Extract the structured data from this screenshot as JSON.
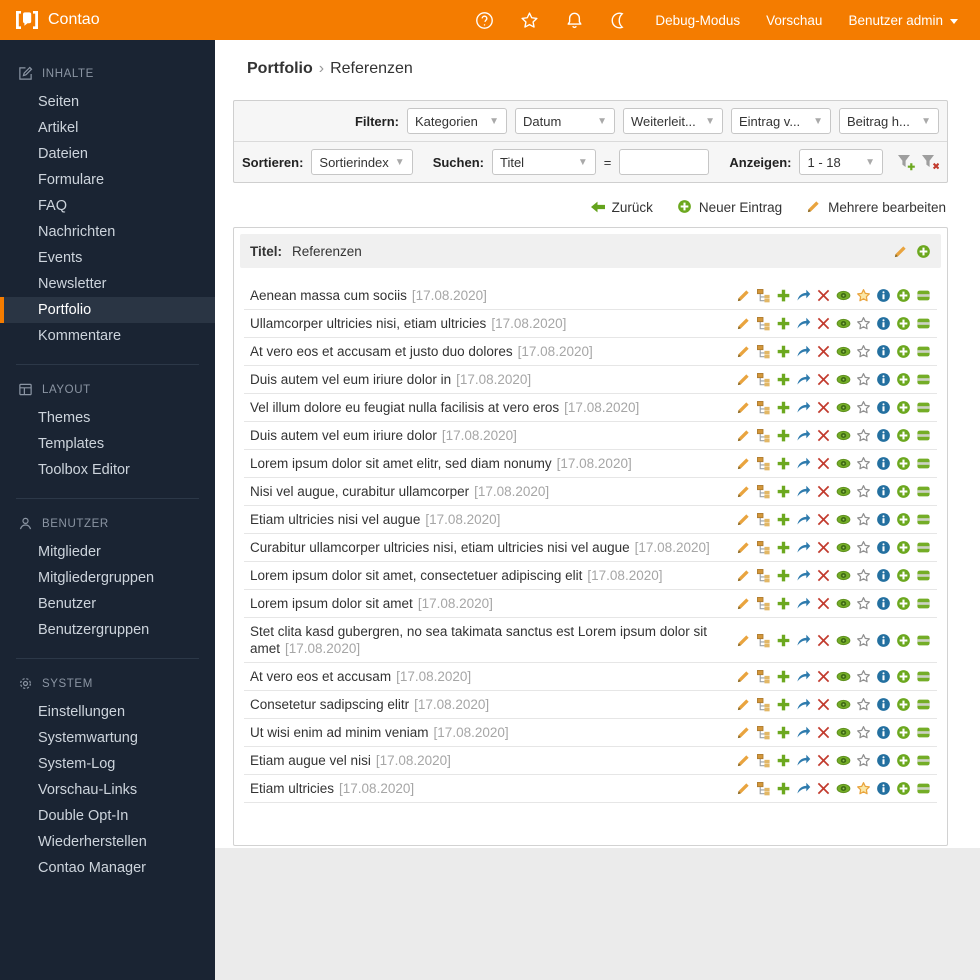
{
  "header": {
    "brand": "Contao",
    "icon_names": [
      "help-icon",
      "favorites-star-icon",
      "notifications-bell-icon",
      "dark-mode-moon-icon"
    ],
    "links": [
      {
        "label": "Debug-Modus"
      },
      {
        "label": "Vorschau"
      },
      {
        "label": "Benutzer admin"
      }
    ]
  },
  "sidebar": {
    "sections": [
      {
        "title": "Inhalte",
        "icon": "edit-square-icon",
        "items": [
          {
            "label": "Seiten"
          },
          {
            "label": "Artikel"
          },
          {
            "label": "Dateien"
          },
          {
            "label": "Formulare"
          },
          {
            "label": "FAQ"
          },
          {
            "label": "Nachrichten"
          },
          {
            "label": "Events"
          },
          {
            "label": "Newsletter"
          },
          {
            "label": "Portfolio",
            "active": true
          },
          {
            "label": "Kommentare"
          }
        ]
      },
      {
        "title": "Layout",
        "icon": "layout-icon",
        "items": [
          {
            "label": "Themes"
          },
          {
            "label": "Templates"
          },
          {
            "label": "Toolbox Editor"
          }
        ]
      },
      {
        "title": "Benutzer",
        "icon": "user-icon",
        "items": [
          {
            "label": "Mitglieder"
          },
          {
            "label": "Mitgliedergruppen"
          },
          {
            "label": "Benutzer"
          },
          {
            "label": "Benutzergruppen"
          }
        ]
      },
      {
        "title": "System",
        "icon": "gear-icon",
        "items": [
          {
            "label": "Einstellungen"
          },
          {
            "label": "Systemwartung"
          },
          {
            "label": "System-Log"
          },
          {
            "label": "Vorschau-Links"
          },
          {
            "label": "Double Opt-In"
          },
          {
            "label": "Wiederherstellen"
          },
          {
            "label": "Contao Manager"
          }
        ]
      }
    ]
  },
  "breadcrumb": {
    "parent": "Portfolio",
    "separator": "›",
    "current": "Referenzen"
  },
  "filter": {
    "label": "Filtern:",
    "selects": [
      {
        "value": "Kategorien"
      },
      {
        "value": "Datum"
      },
      {
        "value": "Weiterleit..."
      },
      {
        "value": "Eintrag v..."
      },
      {
        "value": "Beitrag h..."
      }
    ]
  },
  "sort": {
    "sort_label": "Sortieren:",
    "sort_value": "Sortierindex",
    "search_label": "Suchen:",
    "search_value": "Titel",
    "equals": "=",
    "search_input": "",
    "show_label": "Anzeigen:",
    "show_value": "1 - 18",
    "funnel_icons": [
      "funnel-add-icon",
      "funnel-remove-icon"
    ]
  },
  "actions": [
    {
      "label": "Zurück",
      "icon": "back-arrow-icon"
    },
    {
      "label": "Neuer Eintrag",
      "icon": "new-plus-icon"
    },
    {
      "label": "Mehrere bearbeiten",
      "icon": "edit-pencil-icon"
    }
  ],
  "list": {
    "header_label": "Titel:",
    "header_value": "Referenzen",
    "header_icons": [
      "edit-pencil-icon",
      "new-plus-icon"
    ],
    "row_action_icons": [
      "edit-pencil",
      "children",
      "copy-plus",
      "cut-arrow",
      "delete-x",
      "visibility-eye",
      "feature-star",
      "info",
      "new-after",
      "paste-after"
    ],
    "rows": [
      {
        "title": "Aenean massa cum sociis",
        "date": "[17.08.2020]",
        "featured": true
      },
      {
        "title": "Ullamcorper ultricies nisi, etiam ultricies",
        "date": "[17.08.2020]",
        "featured": false
      },
      {
        "title": "At vero eos et accusam et justo duo dolores",
        "date": "[17.08.2020]",
        "featured": false
      },
      {
        "title": "Duis autem vel eum iriure dolor in",
        "date": "[17.08.2020]",
        "featured": false
      },
      {
        "title": "Vel illum dolore eu feugiat nulla facilisis at vero eros",
        "date": "[17.08.2020]",
        "featured": false
      },
      {
        "title": "Duis autem vel eum iriure dolor",
        "date": "[17.08.2020]",
        "featured": false
      },
      {
        "title": "Lorem ipsum dolor sit amet elitr, sed diam nonumy",
        "date": "[17.08.2020]",
        "featured": false
      },
      {
        "title": "Nisi vel augue, curabitur ullamcorper",
        "date": "[17.08.2020]",
        "featured": false
      },
      {
        "title": "Etiam ultricies nisi vel augue",
        "date": "[17.08.2020]",
        "featured": false
      },
      {
        "title": "Curabitur ullamcorper ultricies nisi, etiam ultricies nisi vel augue",
        "date": "[17.08.2020]",
        "featured": false
      },
      {
        "title": "Lorem ipsum dolor sit amet, consectetuer adipiscing elit",
        "date": "[17.08.2020]",
        "featured": false
      },
      {
        "title": "Lorem ipsum dolor sit amet",
        "date": "[17.08.2020]",
        "featured": false
      },
      {
        "title": "Stet clita kasd gubergren, no sea takimata sanctus est Lorem ipsum dolor sit amet",
        "date": "[17.08.2020]",
        "featured": false
      },
      {
        "title": "At vero eos et accusam",
        "date": "[17.08.2020]",
        "featured": false
      },
      {
        "title": "Consetetur sadipscing elitr",
        "date": "[17.08.2020]",
        "featured": false
      },
      {
        "title": "Ut wisi enim ad minim veniam",
        "date": "[17.08.2020]",
        "featured": false
      },
      {
        "title": "Etiam augue vel nisi",
        "date": "[17.08.2020]",
        "featured": false
      },
      {
        "title": "Etiam ultricies",
        "date": "[17.08.2020]",
        "featured": true
      }
    ]
  },
  "colors": {
    "brand_orange": "#f47c00",
    "sidebar_bg": "#1a2433",
    "green": "#6ca81f",
    "blue": "#2e7bad",
    "red": "#c23b2e",
    "gold": "#e9a33c",
    "info_blue": "#2470a0"
  }
}
